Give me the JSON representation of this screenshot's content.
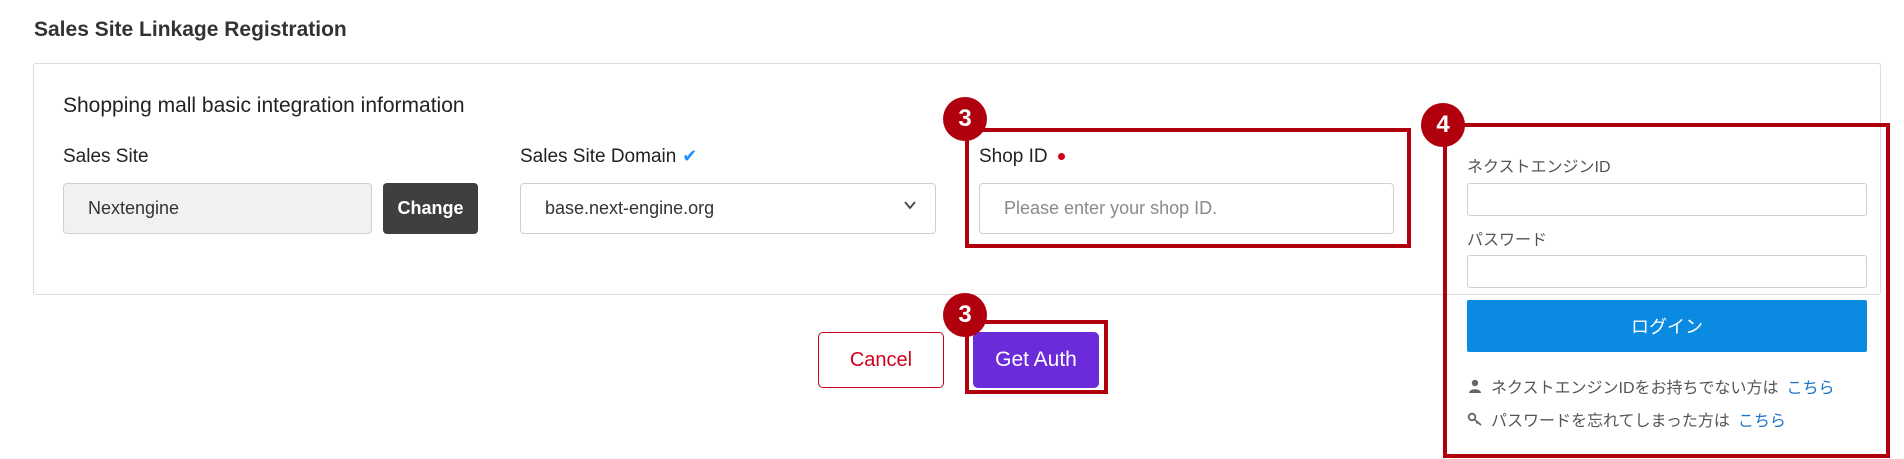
{
  "page": {
    "title": "Sales Site Linkage Registration"
  },
  "section": {
    "title": "Shopping mall basic integration information"
  },
  "sales_site": {
    "label": "Sales Site",
    "value": "Nextengine",
    "change_label": "Change"
  },
  "domain": {
    "label": "Sales Site Domain",
    "selected": "base.next-engine.org"
  },
  "shop_id": {
    "label": "Shop ID",
    "placeholder": "Please enter your shop ID.",
    "value": ""
  },
  "actions": {
    "cancel_label": "Cancel",
    "get_auth_label": "Get Auth"
  },
  "badges": {
    "shop_id_step": "3",
    "get_auth_step": "3",
    "login_panel_step": "4"
  },
  "login_panel": {
    "id_label": "ネクストエンジンID",
    "password_label": "パスワード",
    "login_label": "ログイン",
    "no_id_text": "ネクストエンジンIDをお持ちでない方は",
    "no_id_link": "こちら",
    "forgot_text": "パスワードを忘れてしまった方は",
    "forgot_link": "こちら"
  },
  "colors": {
    "highlight": "#b0000e",
    "primary_purple": "#6c2bd9",
    "login_blue": "#0a8ae0",
    "cancel_red": "#d0021b"
  },
  "icons": {
    "domain_verified": "check-icon",
    "dropdown": "chevron-down-icon",
    "user": "user-icon",
    "key": "key-icon"
  }
}
